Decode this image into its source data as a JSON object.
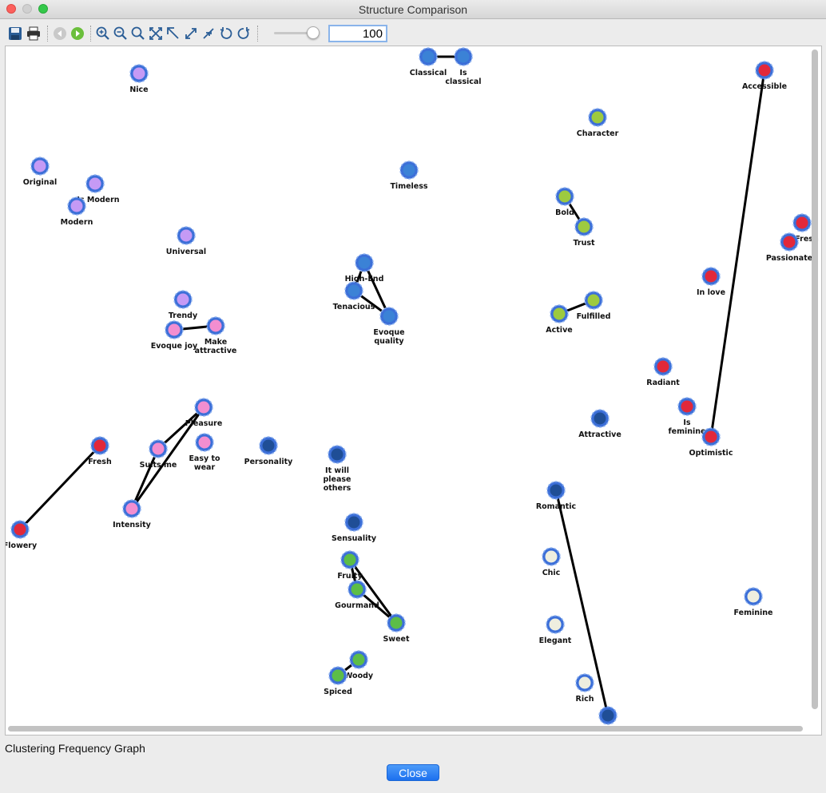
{
  "window": {
    "title": "Structure Comparison"
  },
  "toolbar": {
    "icons": [
      "save-icon",
      "print-icon",
      "back-icon",
      "forward-icon",
      "zoom-in-icon",
      "zoom-out-icon",
      "zoom-fit-icon",
      "fit-all-icon",
      "fit-top-left-icon",
      "expand-icon",
      "collapse-icon",
      "rotate-left-icon",
      "rotate-right-icon"
    ],
    "zoom_value": "100"
  },
  "graph": {
    "colors": {
      "purple": "#c59af5",
      "pink": "#f28ed0",
      "red": "#e2283a",
      "blue": "#3b82d6",
      "navy": "#1f4e96",
      "green": "#5cbd47",
      "lime": "#9dca3f",
      "cream": "#eeeedf"
    },
    "nodes": [
      {
        "label": "Nice",
        "color": "purple"
      },
      {
        "label": "Original",
        "color": "purple"
      },
      {
        "label": "Is Modern",
        "color": "purple"
      },
      {
        "label": "Modern",
        "color": "purple"
      },
      {
        "label": "Universal",
        "color": "purple"
      },
      {
        "label": "Trendy",
        "color": "purple"
      },
      {
        "label": "Evoque joy",
        "color": "pink"
      },
      {
        "label": "Make attractive",
        "color": "pink"
      },
      {
        "label": "Pleasure",
        "color": "pink"
      },
      {
        "label": "Suits me",
        "color": "pink"
      },
      {
        "label": "Easy to wear",
        "color": "pink"
      },
      {
        "label": "Intensity",
        "color": "pink"
      },
      {
        "label": "Fresh",
        "color": "red"
      },
      {
        "label": "Flowery",
        "color": "red"
      },
      {
        "label": "Personality",
        "color": "navy"
      },
      {
        "label": "It will please others",
        "color": "navy"
      },
      {
        "label": "Sensuality",
        "color": "navy"
      },
      {
        "label": "Fruity",
        "color": "green"
      },
      {
        "label": "Gourmand",
        "color": "green"
      },
      {
        "label": "Sweet",
        "color": "green"
      },
      {
        "label": "Woody",
        "color": "green"
      },
      {
        "label": "Spiced",
        "color": "green"
      },
      {
        "label": "Classical",
        "color": "blue"
      },
      {
        "label": "Is classical",
        "color": "blue"
      },
      {
        "label": "Timeless",
        "color": "blue"
      },
      {
        "label": "High-End",
        "color": "blue"
      },
      {
        "label": "Tenacious",
        "color": "blue"
      },
      {
        "label": "Evoque quality",
        "color": "blue"
      },
      {
        "label": "Character",
        "color": "lime"
      },
      {
        "label": "Bold",
        "color": "lime"
      },
      {
        "label": "Trust",
        "color": "lime"
      },
      {
        "label": "Active",
        "color": "lime"
      },
      {
        "label": "Fulfilled",
        "color": "lime"
      },
      {
        "label": "Attractive",
        "color": "navy"
      },
      {
        "label": "Romantic",
        "color": "navy"
      },
      {
        "label": "",
        "color": "navy"
      },
      {
        "label": "Chic",
        "color": "cream"
      },
      {
        "label": "Elegant",
        "color": "cream"
      },
      {
        "label": "Rich",
        "color": "cream"
      },
      {
        "label": "Accessible",
        "color": "red"
      },
      {
        "label": "Fresh",
        "color": "red"
      },
      {
        "label": "Passionate",
        "color": "red"
      },
      {
        "label": "In love",
        "color": "red"
      },
      {
        "label": "Radiant",
        "color": "red"
      },
      {
        "label": "Is feminine",
        "color": "red"
      },
      {
        "label": "Optimistic",
        "color": "red"
      },
      {
        "label": "Feminine",
        "color": "cream"
      }
    ],
    "edges": [
      [
        "Classical",
        "Is classical"
      ],
      [
        "Evoque joy",
        "Make attractive"
      ],
      [
        "Fresh",
        "Flowery"
      ],
      [
        "Pleasure",
        "Suits me"
      ],
      [
        "Pleasure",
        "Intensity"
      ],
      [
        "Suits me",
        "Intensity"
      ],
      [
        "High-End",
        "Tenacious"
      ],
      [
        "High-End",
        "Evoque quality"
      ],
      [
        "Tenacious",
        "Evoque quality"
      ],
      [
        "Bold",
        "Trust"
      ],
      [
        "Active",
        "Fulfilled"
      ],
      [
        "Fruity",
        "Gourmand"
      ],
      [
        "Fruity",
        "Sweet"
      ],
      [
        "Gourmand",
        "Sweet"
      ],
      [
        "Woody",
        "Spiced"
      ],
      [
        "Romantic",
        "#35"
      ],
      [
        "Accessible",
        "Optimistic"
      ]
    ]
  },
  "status": {
    "text": "Clustering Frequency Graph"
  },
  "footer": {
    "close_label": "Close"
  }
}
